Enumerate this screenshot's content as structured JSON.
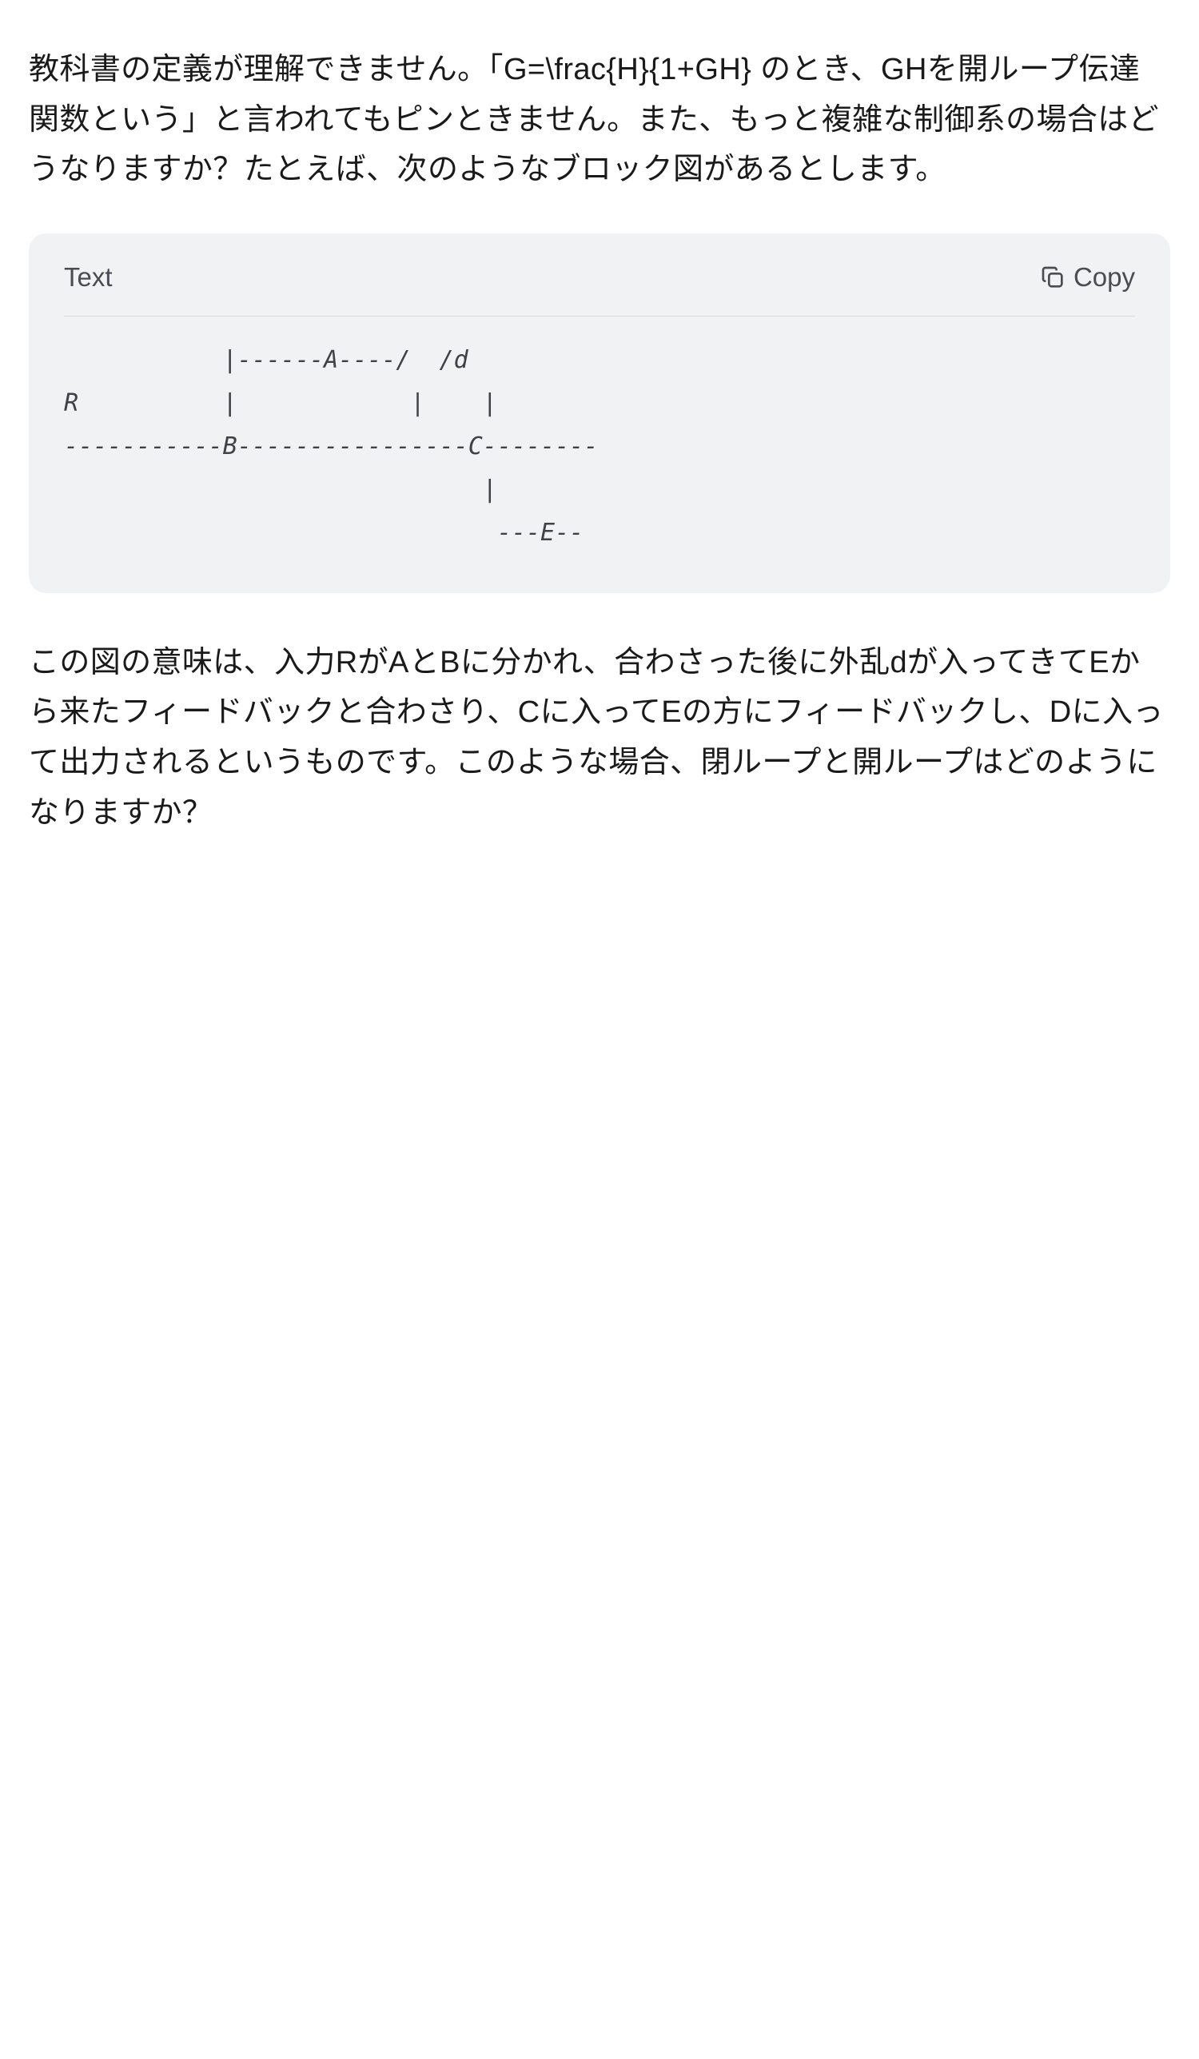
{
  "paragraph_before": "教科書の定義が理解できません。「G=\\frac{H}{1+GH} のとき、GHを開ループ伝達関数という」と言われてもピンときません。また、もっと複雑な制御系の場合はどうなりますか？たとえば、次のようなブロック図があるとします。",
  "code_block": {
    "language": "Text",
    "copy_label": "Copy",
    "lines": [
      "           |------A----/  /d",
      "R          |            |    |",
      "-----------B----------------C--------",
      "                             |",
      "                              ---E--"
    ]
  },
  "paragraph_after": "この図の意味は、入力RがAとBに分かれ、合わさった後に外乱dが入ってきてEから来たフィードバックと合わさり、Cに入ってEの方にフィードバックし、Dに入って出力されるというものです。このような場合、閉ループと開ループはどのようになりますか？"
}
